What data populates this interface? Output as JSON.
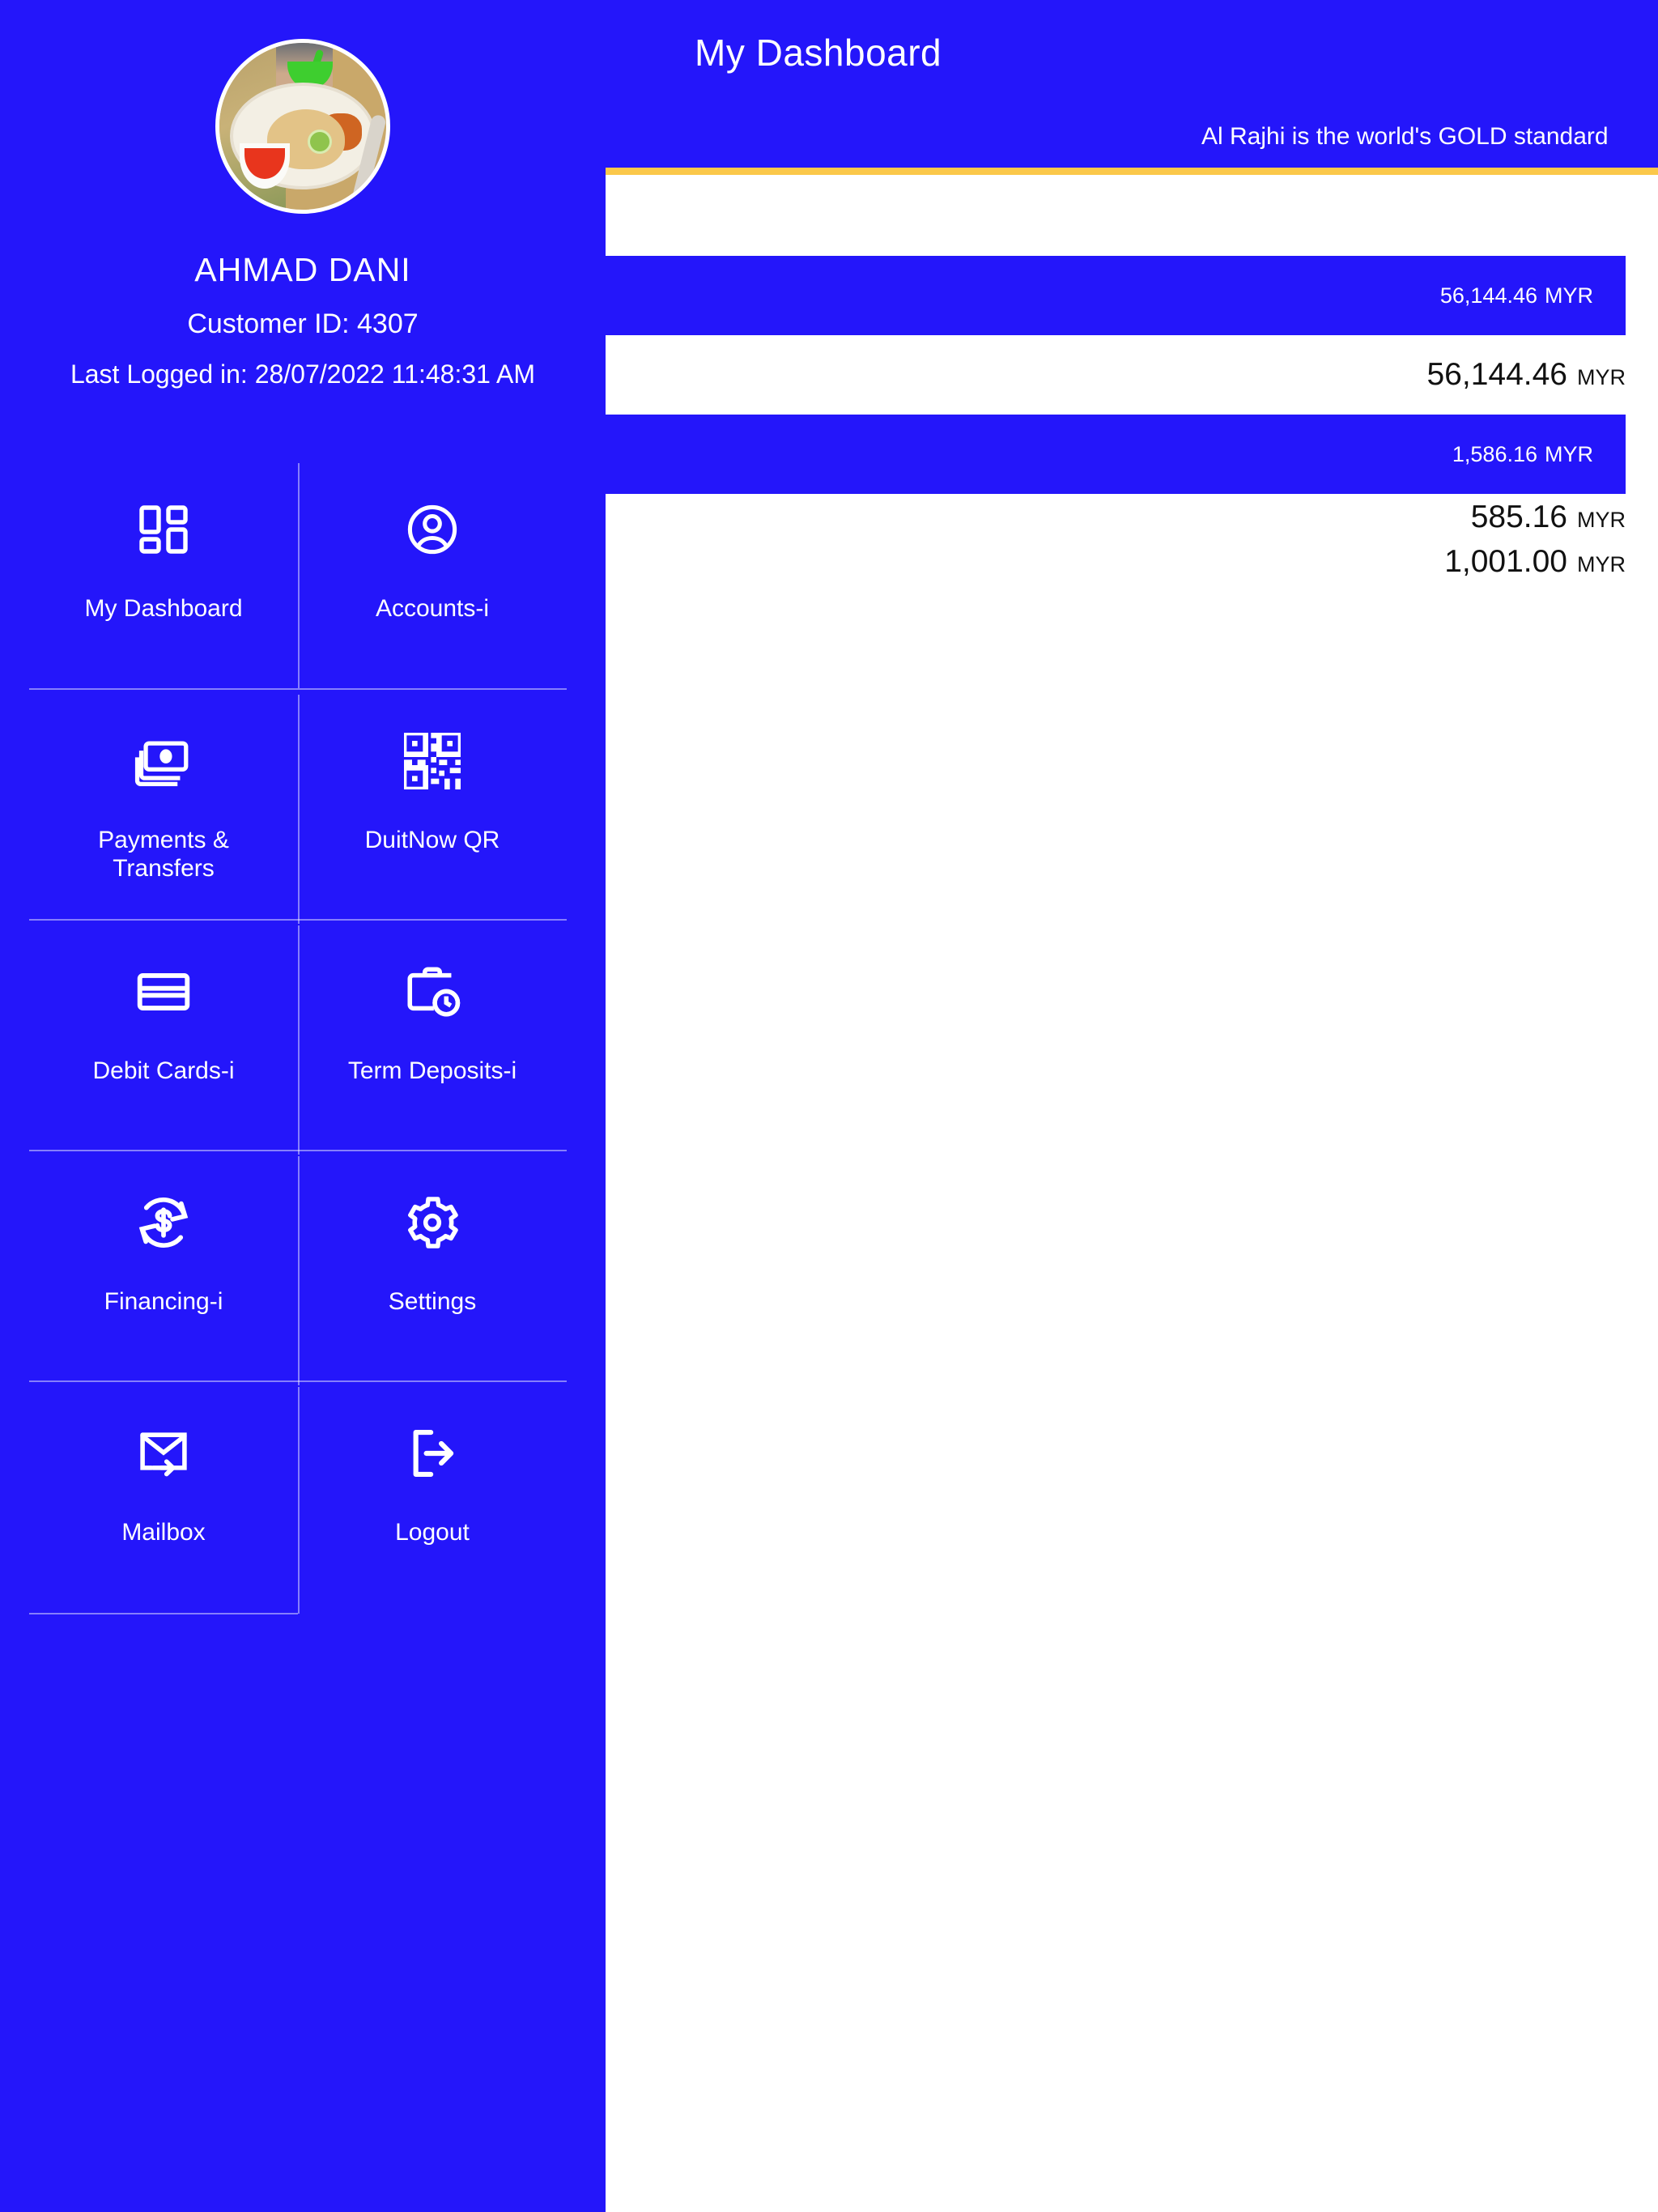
{
  "theme": {
    "brand_blue": "#2416FA",
    "gold": "#FBC84A",
    "white": "#FFFFFF",
    "text_dark": "#111111"
  },
  "sidebar": {
    "avatar_alt": "profile-photo-food-plate",
    "user_name": "AHMAD DANI",
    "customer_id": "Customer ID: 4307",
    "last_logged_in": "Last Logged in: 28/07/2022 11:48:31 AM",
    "menu": [
      {
        "label": "My Dashboard",
        "icon": "dashboard-grid-icon"
      },
      {
        "label": "Accounts-i",
        "icon": "user-circle-icon"
      },
      {
        "label": "Payments &\nTransfers",
        "icon": "banknotes-icon"
      },
      {
        "label": "DuitNow QR",
        "icon": "qr-code-icon"
      },
      {
        "label": "Debit Cards-i",
        "icon": "credit-card-icon"
      },
      {
        "label": "Term Deposits-i",
        "icon": "briefcase-clock-icon"
      },
      {
        "label": "Financing-i",
        "icon": "dollar-refresh-icon"
      },
      {
        "label": "Settings",
        "icon": "gear-icon"
      },
      {
        "label": "Mailbox",
        "icon": "envelope-arrow-icon"
      },
      {
        "label": "Logout",
        "icon": "logout-arrow-icon"
      }
    ]
  },
  "header": {
    "title": "My Dashboard",
    "marquee": "Al Rajhi is the world's GOLD standard"
  },
  "accounts": {
    "currency": "MYR",
    "rows": [
      {
        "style": "blue",
        "value": "56,144.46",
        "currency": "MYR"
      },
      {
        "style": "white",
        "value": "56,144.46",
        "currency": "MYR"
      },
      {
        "style": "blue",
        "value": "1,586.16",
        "currency": "MYR"
      },
      {
        "style": "white",
        "value": "585.16",
        "currency": "MYR"
      },
      {
        "style": "white",
        "value": "1,001.00",
        "currency": "MYR"
      }
    ]
  }
}
